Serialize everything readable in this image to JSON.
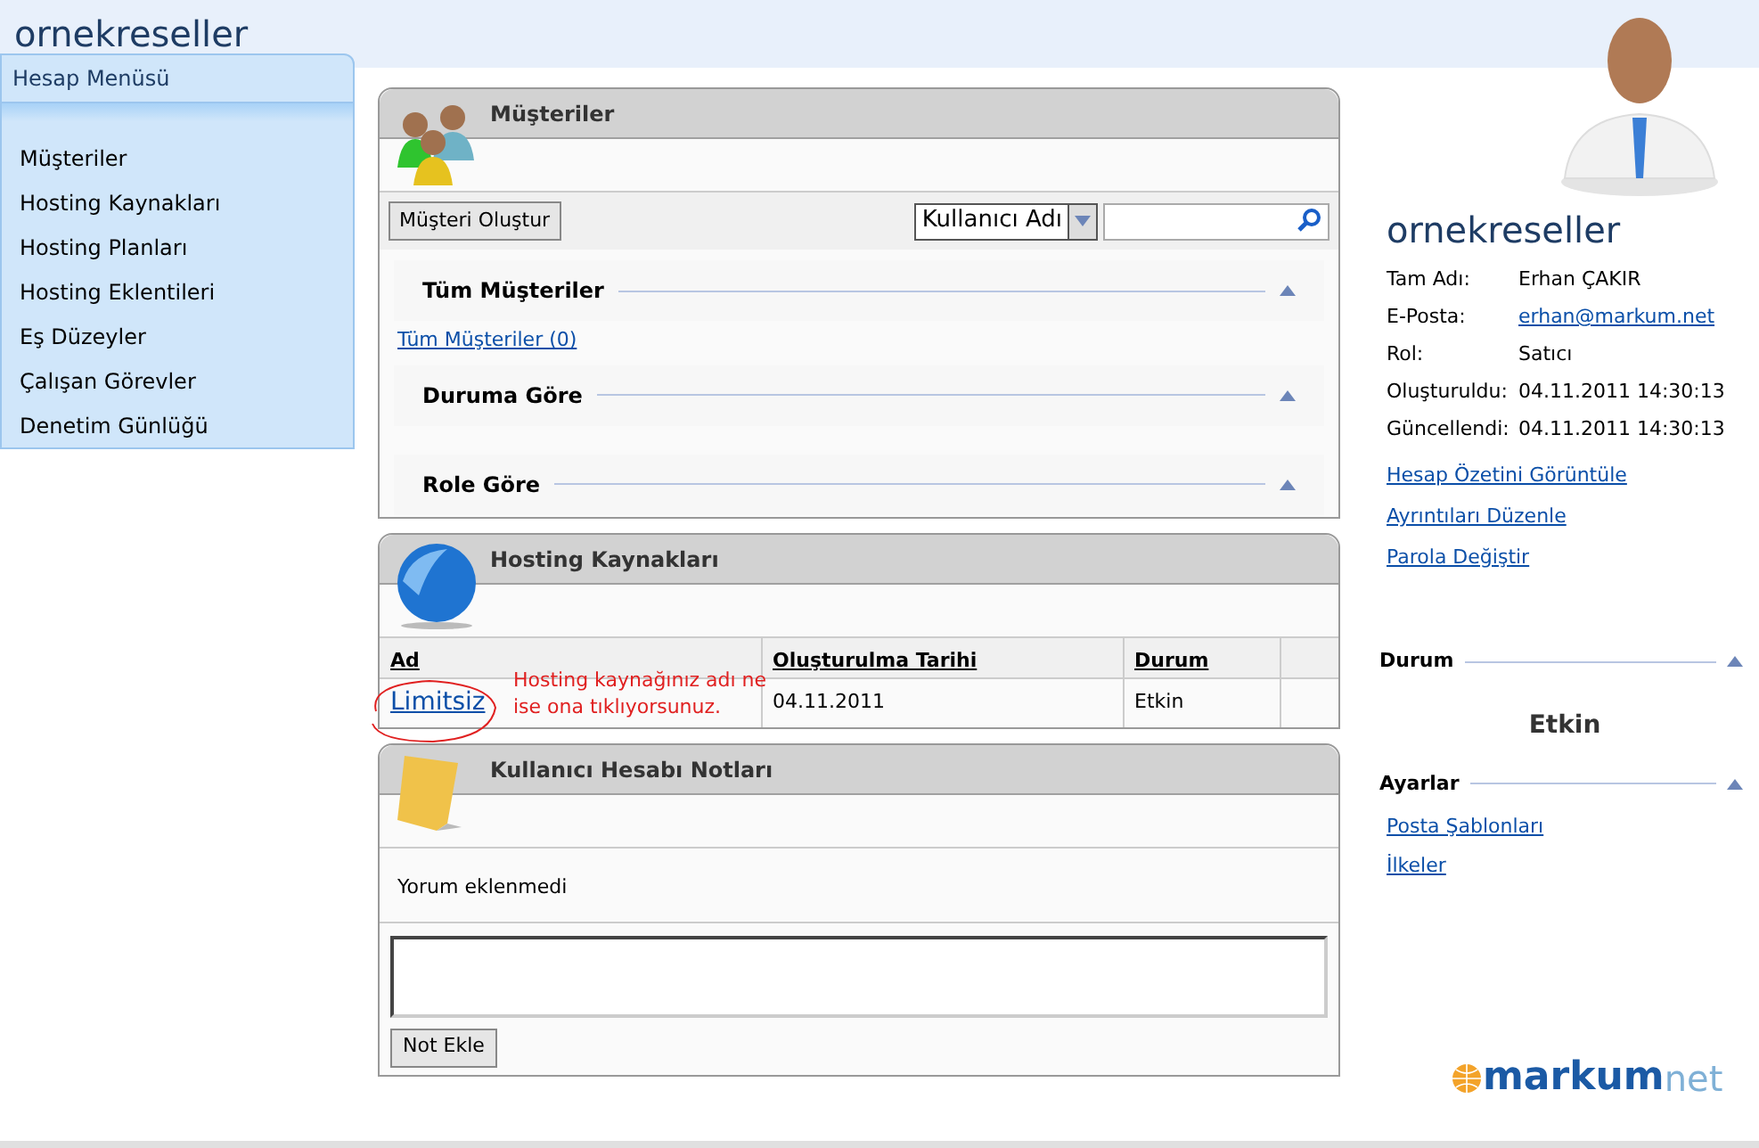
{
  "header": {
    "title": "ornekreseller"
  },
  "sidebar": {
    "title": "Hesap Menüsü",
    "items": [
      "Müşteriler",
      "Hosting Kaynakları",
      "Hosting Planları",
      "Hosting Eklentileri",
      "Eş Düzeyler",
      "Çalışan Görevler",
      "Denetim Günlüğü"
    ]
  },
  "customers_panel": {
    "title": "Müşteriler",
    "create_button": "Müşteri Oluştur",
    "search_by": "Kullanıcı Adı",
    "sections": [
      {
        "title": "Tüm Müşteriler",
        "expanded": true,
        "links": [
          "Tüm Müşteriler (0)"
        ]
      },
      {
        "title": "Duruma Göre",
        "expanded": true
      },
      {
        "title": "Role Göre",
        "expanded": true
      }
    ]
  },
  "hosting_panel": {
    "title": "Hosting Kaynakları",
    "columns": [
      "Ad",
      "Oluşturulma Tarihi",
      "Durum"
    ],
    "rows": [
      {
        "name": "Limitsiz",
        "created": "04.11.2011",
        "status": "Etkin"
      }
    ],
    "annotation": "Hosting kaynağınız adı ne ise ona tıklıyorsunuz."
  },
  "notes_panel": {
    "title": "Kullanıcı Hesabı Notları",
    "empty_text": "Yorum eklenmedi",
    "add_button": "Not Ekle"
  },
  "account": {
    "name": "ornekreseller",
    "fields": [
      {
        "label": "Tam Adı:",
        "value": "Erhan ÇAKIR",
        "kind": "text"
      },
      {
        "label": "E-Posta:",
        "value": "erhan@markum.net",
        "kind": "link"
      },
      {
        "label": "Rol:",
        "value": "Satıcı",
        "kind": "text"
      },
      {
        "label": "Oluşturuldu:",
        "value": "04.11.2011 14:30:13",
        "kind": "text"
      },
      {
        "label": "Güncellendi:",
        "value": "04.11.2011 14:30:13",
        "kind": "text"
      }
    ],
    "links": [
      "Hesap Özetini Görüntüle",
      "Ayrıntıları Düzenle",
      "Parola Değiştir"
    ],
    "status_title": "Durum",
    "status": "Etkin",
    "settings_title": "Ayarlar",
    "settings_links": [
      "Posta Şablonları",
      "İlkeler"
    ]
  },
  "logo": {
    "main": "markum",
    "suffix": "net"
  }
}
